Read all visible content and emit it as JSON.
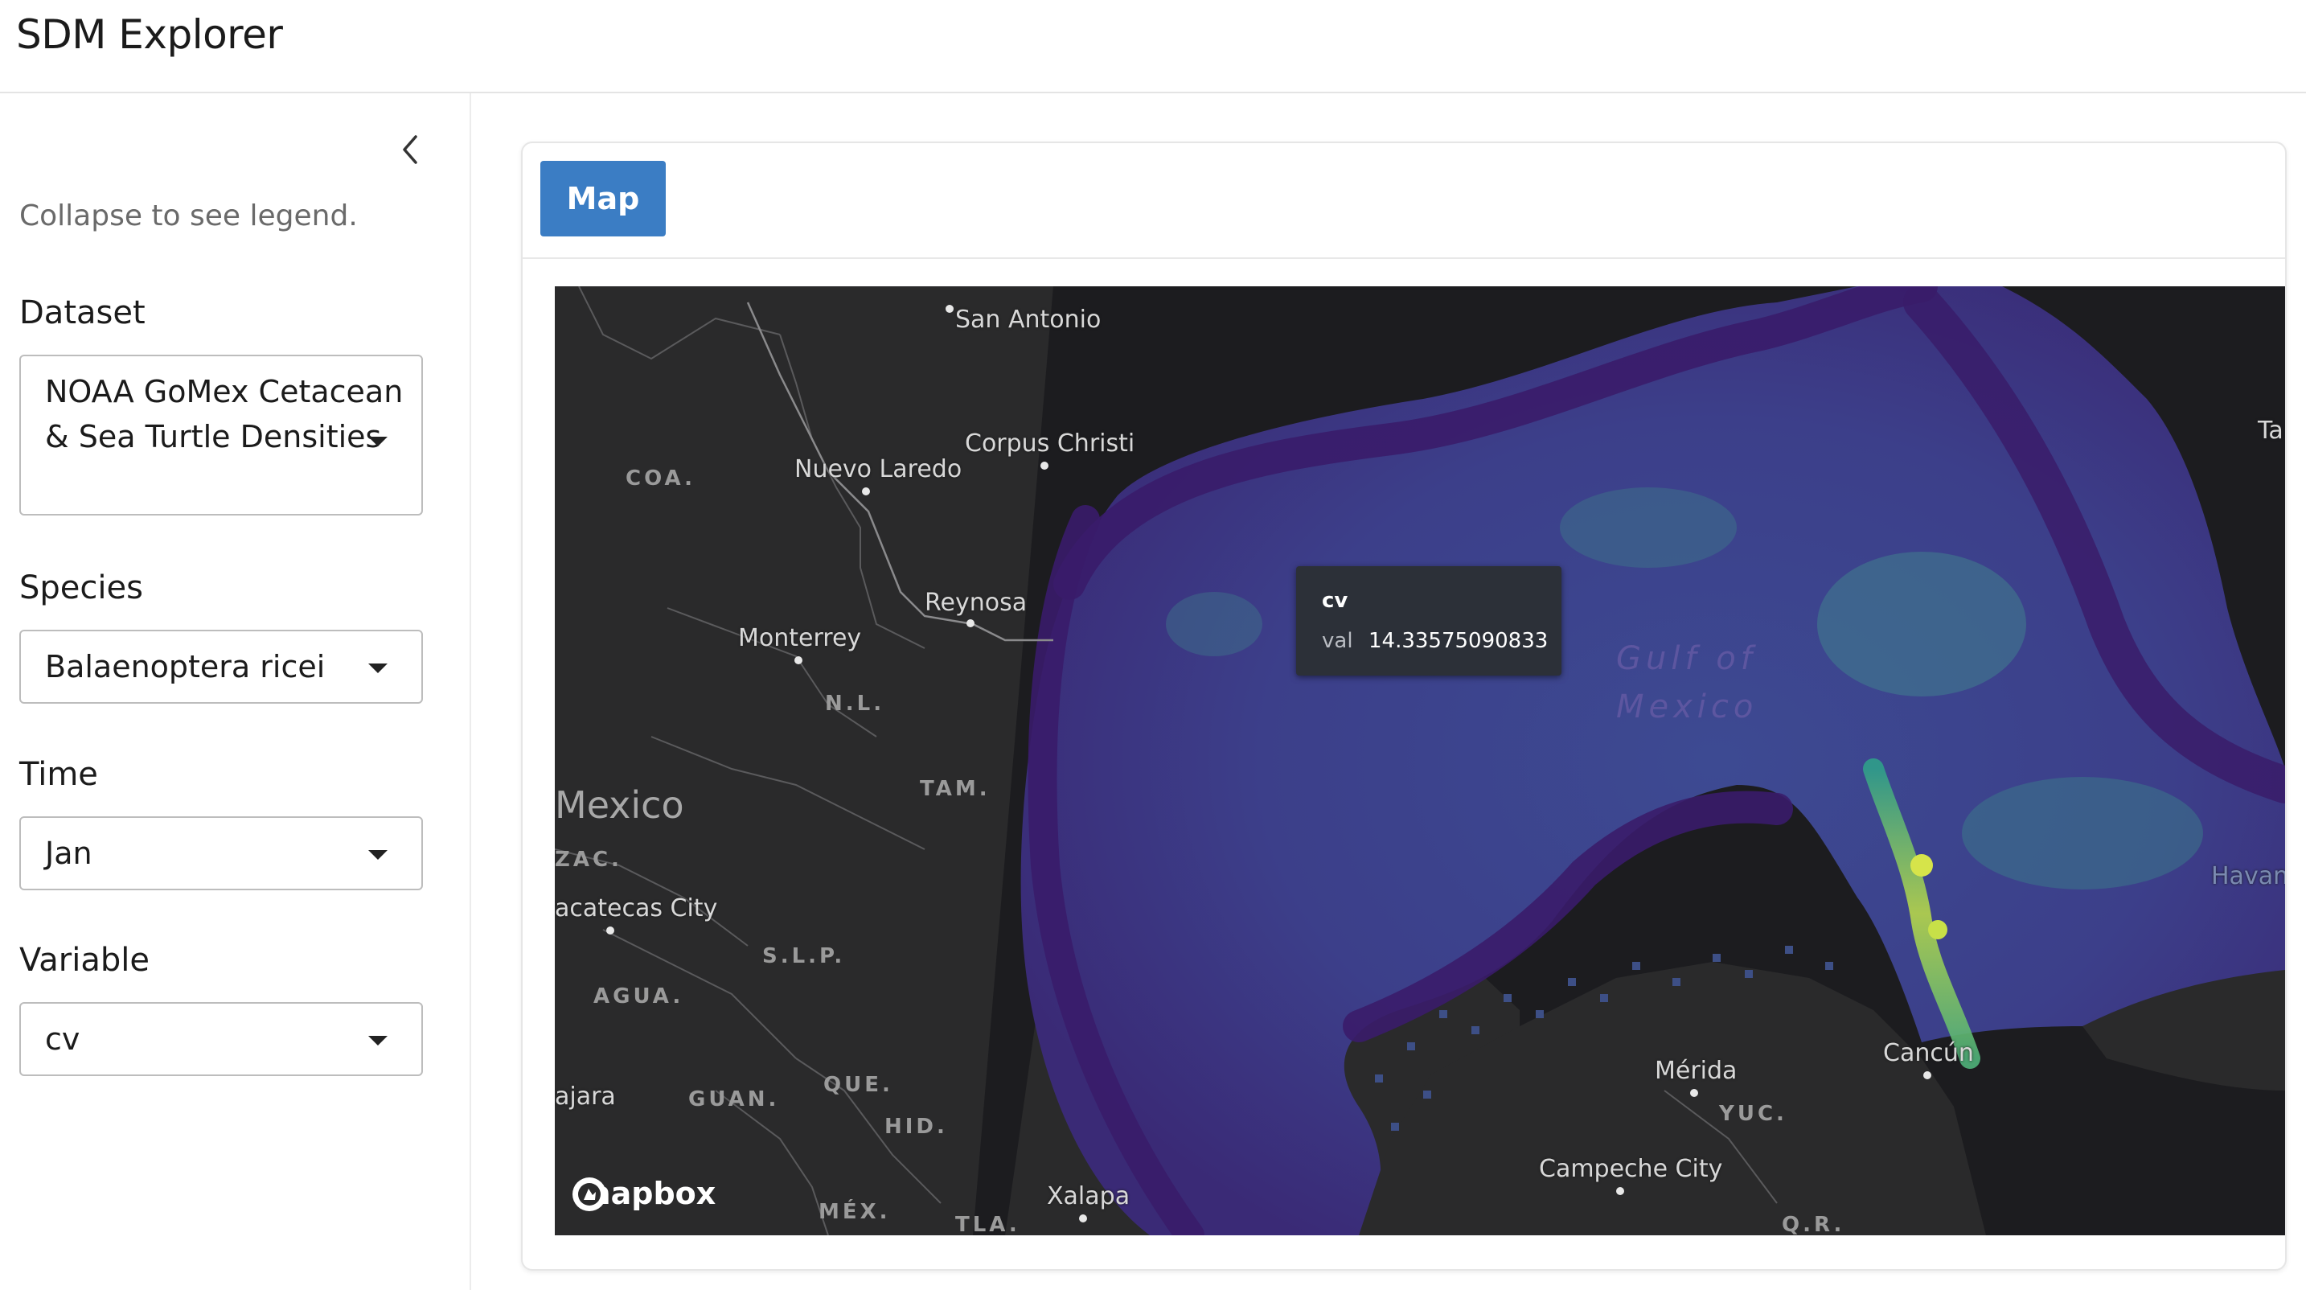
{
  "header": {
    "title": "SDM Explorer"
  },
  "sidebar": {
    "collapse_icon": "chevron-left-icon",
    "hint": "Collapse to see legend.",
    "dataset": {
      "label": "Dataset",
      "value_line1": "NOAA GoMex Cetacean",
      "value_line2": "& Sea Turtle Densities"
    },
    "species": {
      "label": "Species",
      "value": "Balaenoptera ricei"
    },
    "time": {
      "label": "Time",
      "value": "Jan"
    },
    "variable": {
      "label": "Variable",
      "value": "cv"
    }
  },
  "main": {
    "tabs": [
      {
        "label": "Map",
        "active": true
      }
    ],
    "map": {
      "attribution": "mapbox",
      "water_label_line1": "Gulf of",
      "water_label_line2": "Mexico",
      "cities": {
        "san_antonio": "San Antonio",
        "corpus_christi": "Corpus Christi",
        "nuevo_laredo": "Nuevo Laredo",
        "reynosa": "Reynosa",
        "monterrey": "Monterrey",
        "zacatecas": "acatecas City",
        "guadalajara": "ajara",
        "merida": "Mérida",
        "cancun": "Cancún",
        "campeche": "Campeche City",
        "xalapa": "Xalapa",
        "havana": "Havan",
        "tampa": "Ta"
      },
      "regions": {
        "coa": "COA.",
        "nl": "N.L.",
        "tam": "TAM.",
        "zac": "ZAC.",
        "slp": "S.L.P.",
        "agua": "AGUA.",
        "guan": "GUAN.",
        "que": "QUE.",
        "hid": "HID.",
        "mex": "MÉX.",
        "tla": "TLA.",
        "yuc": "YUC.",
        "qr": "Q.R."
      },
      "country": "Mexico",
      "tooltip": {
        "title": "cv",
        "key": "val",
        "value": "14.33575090833"
      },
      "colors": {
        "land": "#2a2a2b",
        "ocean_dark": "#1a1a1c",
        "low": "#3b1d6e",
        "mid": "#3f4f93",
        "high": "#d6e44a"
      }
    }
  }
}
